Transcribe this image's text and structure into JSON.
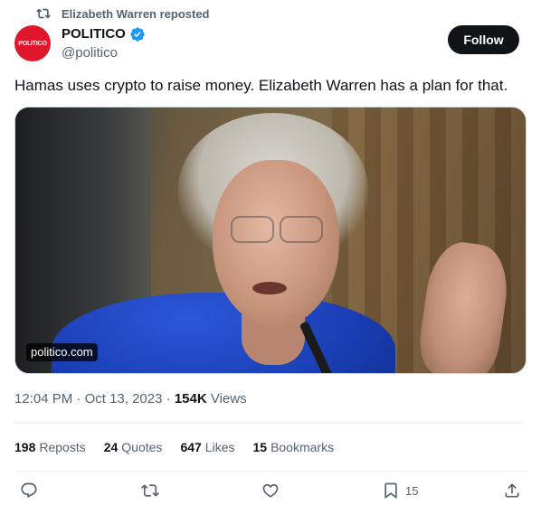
{
  "repost": {
    "label": "Elizabeth Warren reposted",
    "icon": "repost-icon"
  },
  "author": {
    "display_name": "POLITICO",
    "handle": "@politico",
    "avatar_text": "POLITICO",
    "avatar_color": "#e0162b",
    "verified": true
  },
  "follow_label": "Follow",
  "tweet": {
    "text": "Hamas uses crypto to raise money. Elizabeth Warren has a plan for that."
  },
  "media": {
    "source_label": "politico.com"
  },
  "meta": {
    "time": "12:04 PM",
    "date": "Oct 13, 2023",
    "views_count": "154K",
    "views_label": "Views"
  },
  "stats": {
    "reposts_count": "198",
    "reposts_label": "Reposts",
    "quotes_count": "24",
    "quotes_label": "Quotes",
    "likes_count": "647",
    "likes_label": "Likes",
    "bookmarks_count": "15",
    "bookmarks_label": "Bookmarks"
  },
  "actions": {
    "bookmark_count": "15"
  },
  "colors": {
    "text": "#0f1419",
    "secondary": "#536471",
    "verified_blue": "#1d9bf0",
    "border": "#eff3f4"
  }
}
